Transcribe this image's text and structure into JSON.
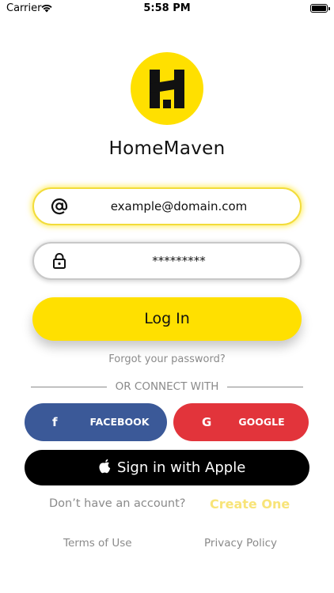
{
  "status_bar": {
    "carrier": "Carrier",
    "time": "5:58 PM"
  },
  "brand": {
    "app_name": "HomeMaven",
    "logo_icon": "homemaven-logo-icon",
    "accent_color": "#FFE000"
  },
  "login_form": {
    "email": {
      "icon": "at-sign-icon",
      "value": "example@domain.com"
    },
    "password": {
      "icon": "lock-icon",
      "value": "*********"
    },
    "login_label": "Log In",
    "forgot_label": "Forgot your password?"
  },
  "divider": {
    "label": "OR CONNECT WITH"
  },
  "social": {
    "facebook": {
      "icon": "facebook-icon",
      "icon_glyph": "f",
      "label": "FACEBOOK",
      "color": "#3B5998"
    },
    "google": {
      "icon": "google-icon",
      "icon_glyph": "G",
      "label": "GOOGLE",
      "color": "#E2343B"
    },
    "apple": {
      "icon": "apple-icon",
      "label": "Sign in with Apple",
      "color": "#000000"
    }
  },
  "signup": {
    "prompt": "Don’t have an account?",
    "link": "Create One"
  },
  "footer": {
    "terms": "Terms of Use",
    "privacy": "Privacy Policy"
  }
}
